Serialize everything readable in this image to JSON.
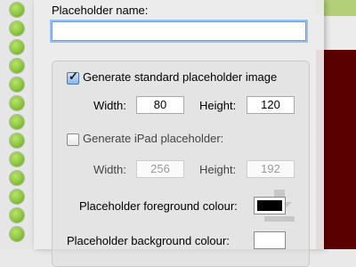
{
  "form": {
    "name_label": "Placeholder name:",
    "name_value": "",
    "standard": {
      "checkbox_label": "Generate standard placeholder image",
      "checked": true,
      "width_label": "Width:",
      "width_value": "80",
      "height_label": "Height:",
      "height_value": "120"
    },
    "ipad": {
      "checkbox_label": "Generate iPad placeholder:",
      "checked": false,
      "width_label": "Width:",
      "width_value": "256",
      "height_label": "Height:",
      "height_value": "192"
    },
    "foreground_label": "Placeholder foreground colour:",
    "foreground_color": "#000000",
    "background_label": "Placeholder background colour:",
    "background_color": "#ffffff"
  },
  "background_app": {
    "status_color": "#8cc63f",
    "accent_dark": "#5a0000"
  }
}
